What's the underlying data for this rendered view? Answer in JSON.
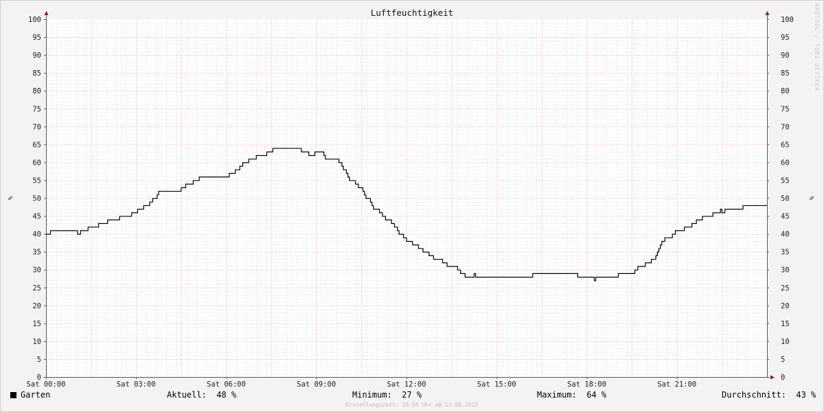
{
  "chart_data": {
    "type": "line",
    "title": "Luftfeuchtigkeit",
    "ylabel_left": "%",
    "ylabel_right": "%",
    "ylim": [
      0,
      100
    ],
    "yticks": [
      0,
      5,
      10,
      15,
      20,
      25,
      30,
      35,
      40,
      45,
      50,
      55,
      60,
      65,
      70,
      75,
      80,
      85,
      90,
      95,
      100
    ],
    "xlim": [
      0,
      24
    ],
    "xticks": [
      {
        "h": 0,
        "label": "Sat 00:00"
      },
      {
        "h": 3,
        "label": "Sat 03:00"
      },
      {
        "h": 6,
        "label": "Sat 06:00"
      },
      {
        "h": 9,
        "label": "Sat 09:00"
      },
      {
        "h": 12,
        "label": "Sat 12:00"
      },
      {
        "h": 15,
        "label": "Sat 15:00"
      },
      {
        "h": 18,
        "label": "Sat 18:00"
      },
      {
        "h": 21,
        "label": "Sat 21:00"
      }
    ],
    "grid": true,
    "series": [
      {
        "name": "Garten",
        "color": "#000000",
        "points": [
          [
            0.0,
            40
          ],
          [
            0.15,
            41
          ],
          [
            1.0,
            41
          ],
          [
            1.05,
            40
          ],
          [
            1.15,
            41
          ],
          [
            1.4,
            42
          ],
          [
            1.75,
            43
          ],
          [
            2.05,
            44
          ],
          [
            2.45,
            45
          ],
          [
            2.85,
            46
          ],
          [
            3.05,
            47
          ],
          [
            3.25,
            48
          ],
          [
            3.45,
            49
          ],
          [
            3.55,
            50
          ],
          [
            3.7,
            51
          ],
          [
            3.75,
            52
          ],
          [
            4.5,
            53
          ],
          [
            4.65,
            54
          ],
          [
            4.9,
            55
          ],
          [
            5.1,
            56
          ],
          [
            6.1,
            57
          ],
          [
            6.3,
            58
          ],
          [
            6.45,
            59
          ],
          [
            6.55,
            60
          ],
          [
            6.75,
            61
          ],
          [
            7.0,
            62
          ],
          [
            7.35,
            63
          ],
          [
            7.55,
            64
          ],
          [
            8.5,
            63
          ],
          [
            8.75,
            62
          ],
          [
            8.95,
            63
          ],
          [
            9.25,
            62
          ],
          [
            9.3,
            61
          ],
          [
            9.75,
            60
          ],
          [
            9.85,
            59
          ],
          [
            9.9,
            58
          ],
          [
            10.0,
            57
          ],
          [
            10.05,
            56
          ],
          [
            10.1,
            55
          ],
          [
            10.3,
            54
          ],
          [
            10.4,
            53
          ],
          [
            10.55,
            52
          ],
          [
            10.6,
            51
          ],
          [
            10.65,
            50
          ],
          [
            10.8,
            49
          ],
          [
            10.85,
            48
          ],
          [
            10.9,
            47
          ],
          [
            11.1,
            46
          ],
          [
            11.2,
            45
          ],
          [
            11.3,
            44
          ],
          [
            11.5,
            43
          ],
          [
            11.6,
            42
          ],
          [
            11.7,
            41
          ],
          [
            11.75,
            40
          ],
          [
            11.9,
            39
          ],
          [
            12.0,
            38
          ],
          [
            12.2,
            37
          ],
          [
            12.4,
            36
          ],
          [
            12.55,
            35
          ],
          [
            12.75,
            34
          ],
          [
            12.9,
            33
          ],
          [
            13.2,
            32
          ],
          [
            13.35,
            31
          ],
          [
            13.7,
            30
          ],
          [
            13.8,
            29
          ],
          [
            13.95,
            28
          ],
          [
            14.25,
            29
          ],
          [
            14.3,
            28
          ],
          [
            16.2,
            29
          ],
          [
            17.7,
            28
          ],
          [
            18.25,
            27
          ],
          [
            18.3,
            28
          ],
          [
            19.05,
            29
          ],
          [
            19.6,
            30
          ],
          [
            19.7,
            31
          ],
          [
            19.95,
            32
          ],
          [
            20.15,
            33
          ],
          [
            20.3,
            34
          ],
          [
            20.35,
            35
          ],
          [
            20.4,
            36
          ],
          [
            20.45,
            37
          ],
          [
            20.5,
            38
          ],
          [
            20.6,
            39
          ],
          [
            20.85,
            40
          ],
          [
            20.95,
            41
          ],
          [
            21.25,
            42
          ],
          [
            21.5,
            43
          ],
          [
            21.65,
            44
          ],
          [
            21.85,
            45
          ],
          [
            22.2,
            46
          ],
          [
            22.45,
            47
          ],
          [
            22.5,
            46
          ],
          [
            22.6,
            47
          ],
          [
            23.2,
            48
          ],
          [
            24.0,
            48
          ]
        ]
      }
    ]
  },
  "legend": {
    "series_name": "Garten",
    "current_label": "Aktuell:",
    "current_value": "48 %",
    "min_label": "Minimum:",
    "min_value": "27 %",
    "max_label": "Maximum:",
    "max_value": "64 %",
    "avg_label": "Durchschnitt:",
    "avg_value": "43 %"
  },
  "footer": "Erstellungszeit: 23:55 Uhr am 13.08.2022",
  "watermark": "RRDTOOL / TOBI OETIKER"
}
